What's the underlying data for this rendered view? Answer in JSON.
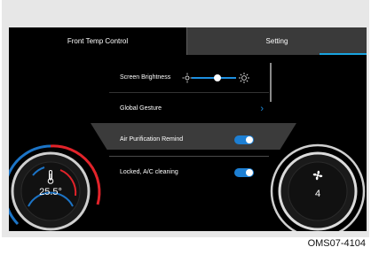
{
  "tabs": {
    "left_label": "Front Temp Control",
    "right_label": "Setting",
    "active": "Setting"
  },
  "settings": {
    "rows": [
      {
        "label": "Screen Brightness",
        "control": "slider"
      },
      {
        "label": "Global Gesture",
        "control": "chevron"
      },
      {
        "label": "Air Purification Remind",
        "control": "toggle",
        "on": true
      },
      {
        "label": "Locked, A/C cleaning",
        "control": "toggle",
        "on": true
      }
    ],
    "brightness_level": 0.75
  },
  "left_dial": {
    "value": "25.5°",
    "icon": "thermometer-icon"
  },
  "right_dial": {
    "value": "4",
    "icon": "fan-icon"
  },
  "colors": {
    "accent": "#1d8fe0",
    "warm": "#e2232a",
    "cool": "#1c74c6"
  },
  "caption": "OMS07-4104"
}
